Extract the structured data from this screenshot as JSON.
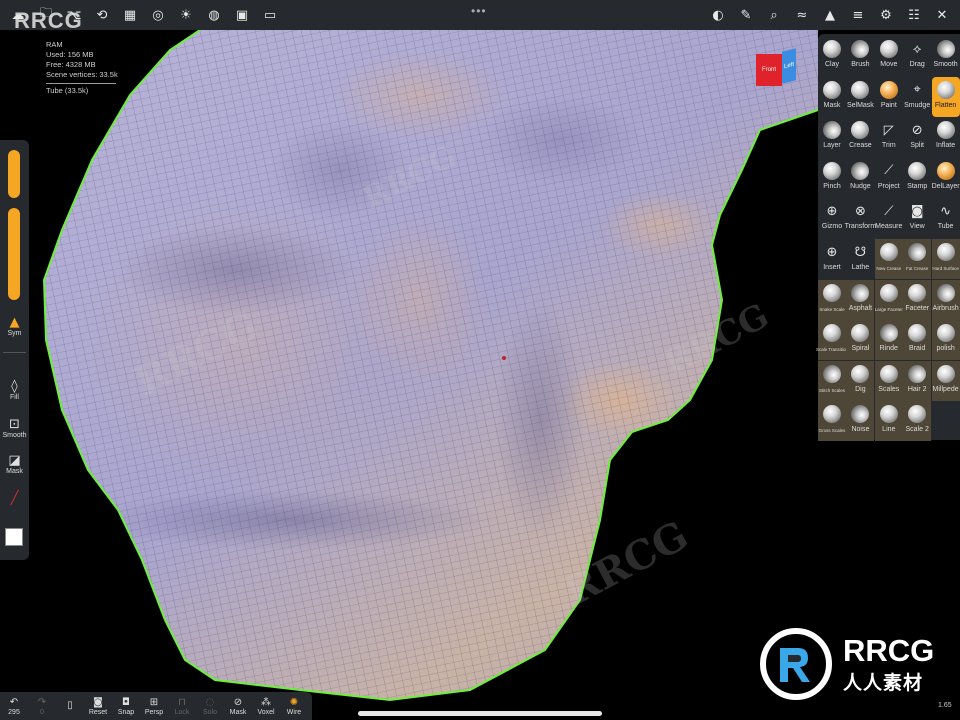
{
  "app": {
    "watermark_logo": "RRCG",
    "fps": "1.65"
  },
  "stats": {
    "title": "RAM",
    "used": "Used: 156 MB",
    "free": "Free: 4328 MB",
    "vertices": "Scene vertices: 33.5k",
    "object": "Tube (33.5k)"
  },
  "viewcube": {
    "front_label": "Front",
    "left_label": "Left",
    "front_color": "#e0222a",
    "left_color": "#3a8de0"
  },
  "left_panel": {
    "accent_color": "#f5a623",
    "items": [
      {
        "icon": "warning-icon",
        "label": "Sym"
      },
      {
        "icon": "drop-icon",
        "label": "Fill"
      },
      {
        "icon": "square-plus-icon",
        "label": "Smooth"
      },
      {
        "icon": "mask-square-icon",
        "label": "Mask"
      }
    ]
  },
  "bottom_bar": {
    "undo_count": "295",
    "redo_count": "0",
    "items": [
      {
        "label": "Reset",
        "icon": "camera-reset-icon"
      },
      {
        "label": "Snap",
        "icon": "camera-snap-icon"
      },
      {
        "label": "Persp",
        "icon": "perspective-icon"
      },
      {
        "label": "Lock",
        "icon": "lock-icon"
      },
      {
        "label": "Solo",
        "icon": "solo-icon"
      },
      {
        "label": "Mask",
        "icon": "eye-slash-icon"
      },
      {
        "label": "Voxel",
        "icon": "voxel-icon"
      },
      {
        "label": "Wire",
        "icon": "wire-icon"
      }
    ]
  },
  "tools": [
    {
      "label": "Clay"
    },
    {
      "label": "Brush"
    },
    {
      "label": "Move"
    },
    {
      "label": "Drag"
    },
    {
      "label": "Smooth"
    },
    {
      "label": "Mask"
    },
    {
      "label": "SelMask"
    },
    {
      "label": "Paint"
    },
    {
      "label": "Smudge"
    },
    {
      "label": "Flatten"
    },
    {
      "label": "Layer"
    },
    {
      "label": "Crease"
    },
    {
      "label": "Trim"
    },
    {
      "label": "Split"
    },
    {
      "label": "Inflate"
    },
    {
      "label": "Pinch"
    },
    {
      "label": "Nudge"
    },
    {
      "label": "Project"
    },
    {
      "label": "Stamp"
    },
    {
      "label": "DelLayer"
    },
    {
      "label": "Gizmo"
    },
    {
      "label": "Transform"
    },
    {
      "label": "Measure"
    },
    {
      "label": "View"
    },
    {
      "label": "Tube"
    },
    {
      "label": "Insert"
    },
    {
      "label": "Lathe"
    },
    {
      "label": "New Crease"
    },
    {
      "label": "Fat Crease"
    },
    {
      "label": "Hard Surface"
    },
    {
      "label": "Snake Scale"
    },
    {
      "label": "Asphalt"
    },
    {
      "label": "Large Faceter"
    },
    {
      "label": "Faceter"
    },
    {
      "label": "Airbrush"
    },
    {
      "label": "Scale Transition"
    },
    {
      "label": "Spiral"
    },
    {
      "label": "Rinde"
    },
    {
      "label": "Braid"
    },
    {
      "label": "polish"
    },
    {
      "label": "Stitch Scales"
    },
    {
      "label": "Dig"
    },
    {
      "label": "Scales"
    },
    {
      "label": "Hair 2"
    },
    {
      "label": "Millpede"
    },
    {
      "label": "Gross Scales"
    },
    {
      "label": "Noise"
    },
    {
      "label": "Line"
    },
    {
      "label": "Scale 2"
    }
  ],
  "selected_tool": "Flatten",
  "brand": {
    "name": "RRCG",
    "subtitle": "人人素材"
  }
}
